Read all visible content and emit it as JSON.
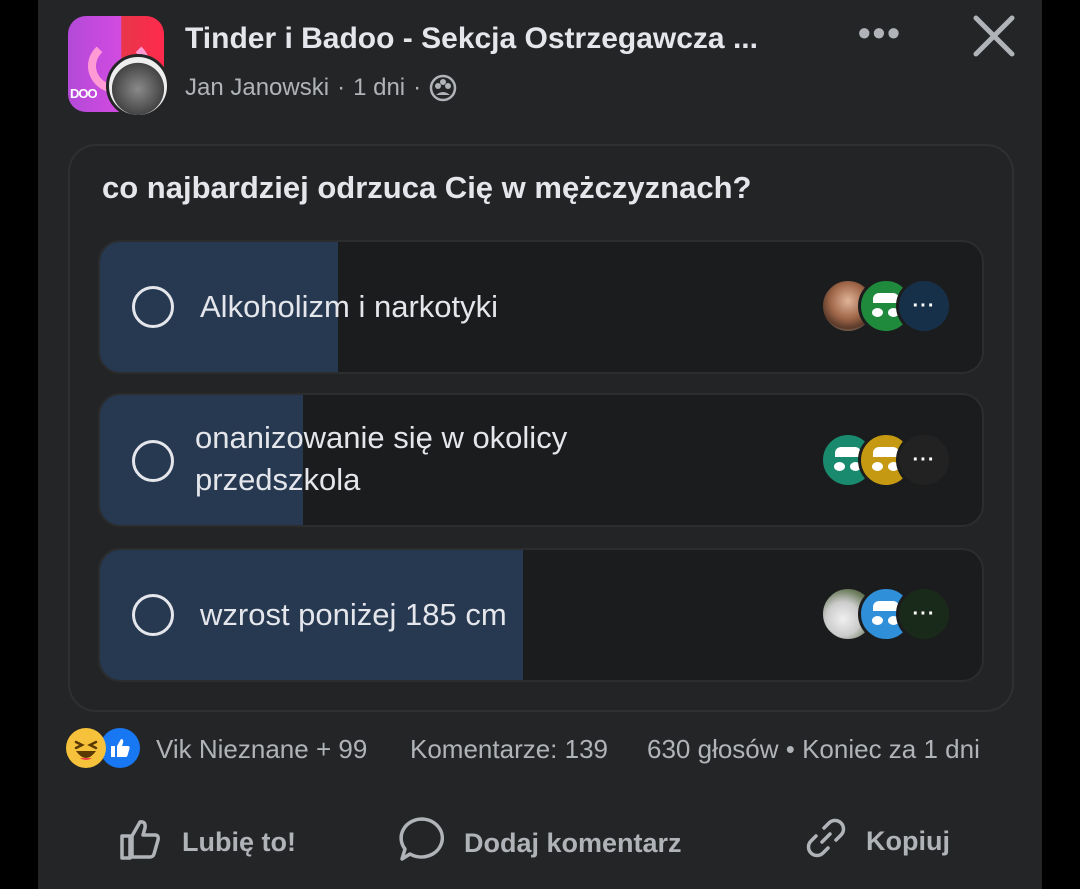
{
  "post": {
    "group_name": "Tinder i Badoo - Sekcja Ostrzegawcza ...",
    "group_logo_text": "DOO",
    "author": "Jan Janowski",
    "sep1": "·",
    "time": "1 dni",
    "sep2": "·",
    "privacy_icon": "group-icon"
  },
  "poll": {
    "question": "co najbardziej odrzuca Cię w mężczyznach?",
    "options": [
      {
        "label": "Alkoholizm i narkotyki",
        "fraction": 0.27,
        "voters": [
          "photo",
          "anon-green",
          "more-dark"
        ]
      },
      {
        "label": "onanizowanie się w okolicy przedszkola",
        "fraction": 0.23,
        "voters": [
          "anon-teal",
          "anon-yellow",
          "more-dark"
        ]
      },
      {
        "label": "wzrost poniżej 185 cm",
        "fraction": 0.48,
        "voters": [
          "photo",
          "anon-blue",
          "more-dark"
        ]
      }
    ]
  },
  "footer": {
    "reactors": "Vik Nieznane + 99",
    "comments": "Komentarze: 139",
    "votes": "630 głosów • Koniec za 1 dni",
    "like_label": "Lubię to!",
    "comment_label": "Dodaj komentarz",
    "copy_label": "Kopiuj"
  },
  "colors": {
    "background": "#242526",
    "poll_fill": "#263951",
    "anon_green": "#1f8a3c",
    "anon_teal": "#1a8a6e",
    "anon_yellow": "#c59a12",
    "anon_blue": "#2f8fd8"
  }
}
